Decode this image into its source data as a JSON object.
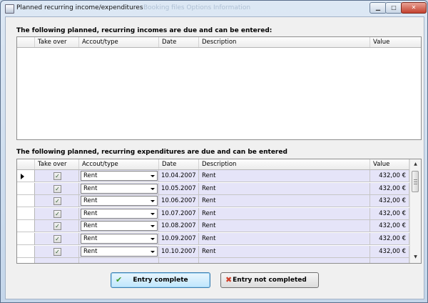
{
  "window": {
    "title": "Planned recurring income/expenditures",
    "background_title": "Booking files Options Information"
  },
  "income": {
    "label": "The following planned, recurring incomes are due and can be entered:",
    "columns": [
      "Take over",
      "Accout/type",
      "Date",
      "Description",
      "Value"
    ]
  },
  "expenditure": {
    "label": "The following planned, recurring expenditures are due and can be entered",
    "columns": [
      "Take over",
      "Accout/type",
      "Date",
      "Description",
      "Value"
    ],
    "rows": [
      {
        "checked": true,
        "account": "Rent",
        "date": "10.04.2007",
        "description": "Rent",
        "value": "432,00 €"
      },
      {
        "checked": true,
        "account": "Rent",
        "date": "10.05.2007",
        "description": "Rent",
        "value": "432,00 €"
      },
      {
        "checked": true,
        "account": "Rent",
        "date": "10.06.2007",
        "description": "Rent",
        "value": "432,00 €"
      },
      {
        "checked": true,
        "account": "Rent",
        "date": "10.07.2007",
        "description": "Rent",
        "value": "432,00 €"
      },
      {
        "checked": true,
        "account": "Rent",
        "date": "10.08.2007",
        "description": "Rent",
        "value": "432,00 €"
      },
      {
        "checked": true,
        "account": "Rent",
        "date": "10.09.2007",
        "description": "Rent",
        "value": "432,00 €"
      },
      {
        "checked": true,
        "account": "Rent",
        "date": "10.10.2007",
        "description": "Rent",
        "value": "432,00 €"
      }
    ]
  },
  "buttons": {
    "complete": "Entry complete",
    "not_completed": "Entry not completed"
  },
  "icons": {
    "complete": "check-icon",
    "not_completed": "x-icon",
    "row_pointer": "row-pointer-icon"
  },
  "colors": {
    "row_background": "#e5e4f8",
    "complete_icon": "#3a9a2a",
    "cancel_icon": "#d0402a"
  }
}
